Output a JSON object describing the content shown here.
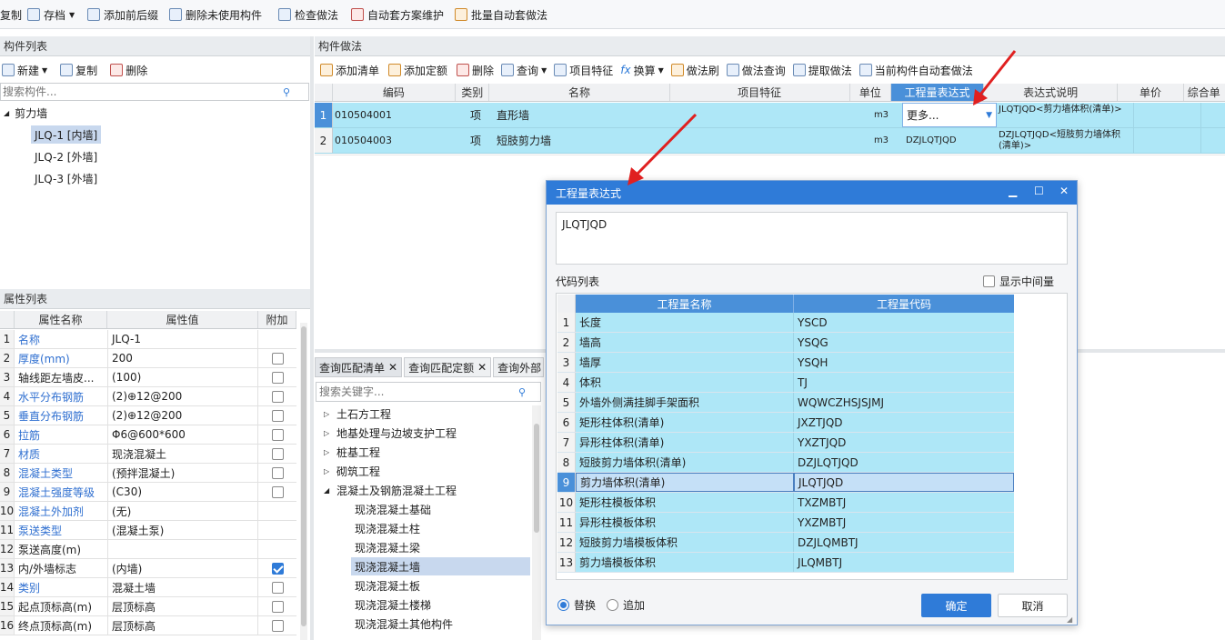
{
  "toolbar": {
    "items": [
      "复制",
      "存档",
      "添加前后缀",
      "删除未使用构件",
      "检查做法",
      "自动套方案维护",
      "批量自动套做法"
    ]
  },
  "component_list": {
    "title": "构件列表",
    "new": "新建",
    "copy": "复制",
    "delete": "删除",
    "search_placeholder": "搜索构件...",
    "group": "剪力墙",
    "items": [
      "JLQ-1 [内墙]",
      "JLQ-2 [外墙]",
      "JLQ-3 [外墙]"
    ]
  },
  "property_list": {
    "title": "属性列表",
    "headers": [
      "属性名称",
      "属性值",
      "附加"
    ],
    "rows": [
      {
        "n": "1",
        "name": "名称",
        "value": "JLQ-1",
        "blue": true,
        "cb": "none"
      },
      {
        "n": "2",
        "name": "厚度(mm)",
        "value": "200",
        "blue": true,
        "cb": "off"
      },
      {
        "n": "3",
        "name": "轴线距左墙皮...",
        "value": "(100)",
        "blue": false,
        "cb": "off"
      },
      {
        "n": "4",
        "name": "水平分布钢筋",
        "value": "(2)⊕12@200",
        "blue": true,
        "cb": "off"
      },
      {
        "n": "5",
        "name": "垂直分布钢筋",
        "value": "(2)⊕12@200",
        "blue": true,
        "cb": "off"
      },
      {
        "n": "6",
        "name": "拉筋",
        "value": "Φ6@600*600",
        "blue": true,
        "cb": "off"
      },
      {
        "n": "7",
        "name": "材质",
        "value": "现浇混凝土",
        "blue": true,
        "cb": "off"
      },
      {
        "n": "8",
        "name": "混凝土类型",
        "value": "(预拌混凝土)",
        "blue": true,
        "cb": "off"
      },
      {
        "n": "9",
        "name": "混凝土强度等级",
        "value": "(C30)",
        "blue": true,
        "cb": "off"
      },
      {
        "n": "10",
        "name": "混凝土外加剂",
        "value": "(无)",
        "blue": true,
        "cb": "none"
      },
      {
        "n": "11",
        "name": "泵送类型",
        "value": "(混凝土泵)",
        "blue": true,
        "cb": "none"
      },
      {
        "n": "12",
        "name": "泵送高度(m)",
        "value": "",
        "blue": false,
        "cb": "none"
      },
      {
        "n": "13",
        "name": "内/外墙标志",
        "value": "(内墙)",
        "blue": false,
        "cb": "on"
      },
      {
        "n": "14",
        "name": "类别",
        "value": "混凝土墙",
        "blue": true,
        "cb": "off"
      },
      {
        "n": "15",
        "name": "起点顶标高(m)",
        "value": "层顶标高",
        "blue": false,
        "cb": "off"
      },
      {
        "n": "16",
        "name": "终点顶标高(m)",
        "value": "层顶标高",
        "blue": false,
        "cb": "off"
      }
    ]
  },
  "method": {
    "title": "构件做法",
    "toolbar": [
      "添加清单",
      "添加定额",
      "删除",
      "查询",
      "项目特征",
      "换算",
      "做法刷",
      "做法查询",
      "提取做法",
      "当前构件自动套做法"
    ],
    "headers": [
      "编码",
      "类别",
      "名称",
      "项目特征",
      "单位",
      "工程量表达式",
      "表达式说明",
      "单价",
      "综合单"
    ],
    "rows": [
      {
        "n": "1",
        "code": "010504001",
        "cat": "项",
        "name": "直形墙",
        "feature": "",
        "unit": "m3",
        "expr": "更多...",
        "desc": "JLQTJQD<剪力墙体积(清单)>"
      },
      {
        "n": "2",
        "code": "010504003",
        "cat": "项",
        "name": "短肢剪力墙",
        "feature": "",
        "unit": "m3",
        "expr": "DZJLQTJQD",
        "desc": "DZJLQTJQD<短肢剪力墙体积(清单)>"
      }
    ]
  },
  "query": {
    "tabs": [
      "查询匹配清单",
      "查询匹配定额",
      "查询外部"
    ],
    "search_placeholder": "搜索关键字...",
    "tree": [
      "土石方工程",
      "地基处理与边坡支护工程",
      "桩基工程",
      "砌筑工程",
      "混凝土及钢筋混凝土工程"
    ],
    "subtree": [
      "现浇混凝土基础",
      "现浇混凝土柱",
      "现浇混凝土梁",
      "现浇混凝土墙",
      "现浇混凝土板",
      "现浇混凝土楼梯",
      "现浇混凝土其他构件"
    ]
  },
  "dialog": {
    "title": "工程量表达式",
    "expression": "JLQTJQD",
    "code_list_label": "代码列表",
    "show_intermediate": "显示中间量",
    "headers": [
      "工程量名称",
      "工程量代码"
    ],
    "rows": [
      {
        "n": "1",
        "name": "长度",
        "code": "YSCD"
      },
      {
        "n": "2",
        "name": "墙高",
        "code": "YSQG"
      },
      {
        "n": "3",
        "name": "墙厚",
        "code": "YSQH"
      },
      {
        "n": "4",
        "name": "体积",
        "code": "TJ"
      },
      {
        "n": "5",
        "name": "外墙外侧满挂脚手架面积",
        "code": "WQWCZHSJSJMJ"
      },
      {
        "n": "6",
        "name": "矩形柱体积(清单)",
        "code": "JXZTJQD"
      },
      {
        "n": "7",
        "name": "异形柱体积(清单)",
        "code": "YXZTJQD"
      },
      {
        "n": "8",
        "name": "短肢剪力墙体积(清单)",
        "code": "DZJLQTJQD"
      },
      {
        "n": "9",
        "name": "剪力墙体积(清单)",
        "code": "JLQTJQD"
      },
      {
        "n": "10",
        "name": "矩形柱模板体积",
        "code": "TXZMBTJ"
      },
      {
        "n": "11",
        "name": "异形柱模板体积",
        "code": "YXZMBTJ"
      },
      {
        "n": "12",
        "name": "短肢剪力墙模板体积",
        "code": "DZJLQMBTJ"
      },
      {
        "n": "13",
        "name": "剪力墙模板体积",
        "code": "JLQMBTJ"
      }
    ],
    "replace": "替换",
    "append": "追加",
    "ok": "确定",
    "cancel": "取消"
  },
  "colors": {
    "accent": "#2f7bd8",
    "row_selected": "#aee7f7",
    "arrow": "#e02020"
  }
}
